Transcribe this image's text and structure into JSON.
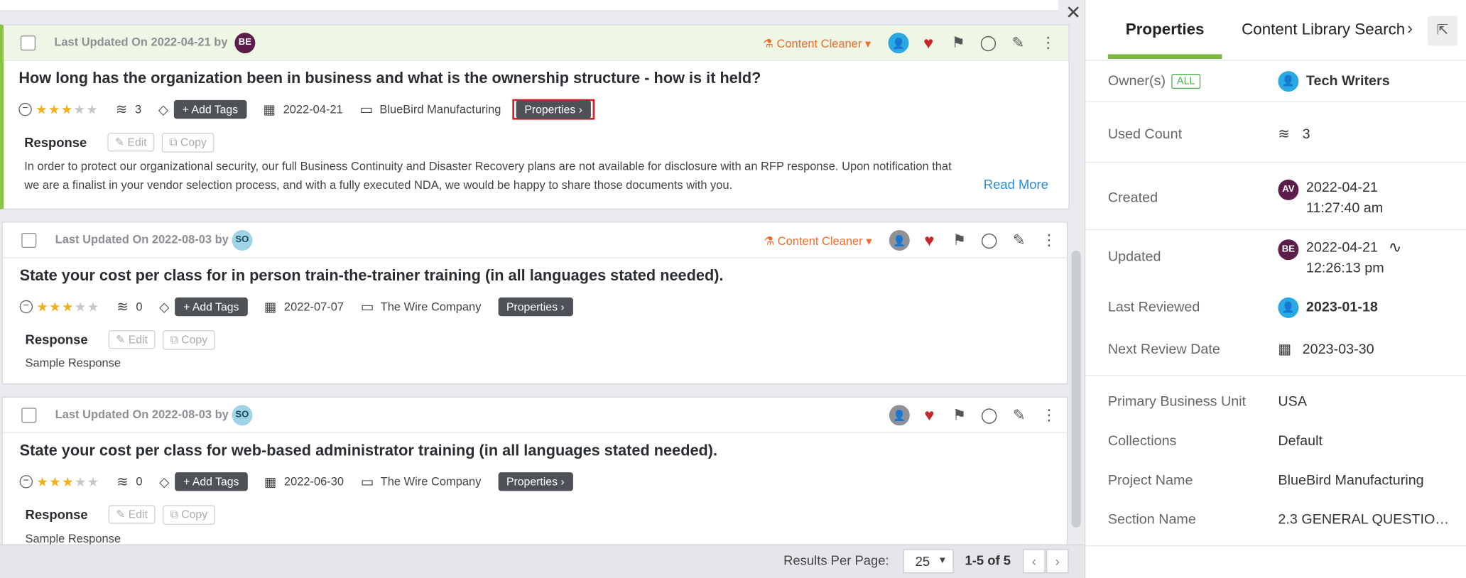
{
  "list": {
    "cards": [
      {
        "updated_label": "Last Updated On 2022-04-21 by",
        "avatar": "BE",
        "content_cleaner": "Content Cleaner",
        "question": "How long has the organization been in business and what is the ownership structure - how is it held?",
        "rating": 3,
        "used_count": "3",
        "add_tags": "+ Add Tags",
        "date": "2022-04-21",
        "project": "BlueBird Manufacturing",
        "properties": "Properties",
        "response_label": "Response",
        "edit": "Edit",
        "copy": "Copy",
        "response_text": "In order to protect our organizational security, our full Business Continuity and Disaster Recovery plans are not available for disclosure with an RFP response. Upon notification that we are a finalist in your vendor selection process, and with a fully executed NDA, we would be happy to share those documents with you.",
        "read_more": "Read More"
      },
      {
        "updated_label": "Last Updated On 2022-08-03 by",
        "avatar": "SO",
        "content_cleaner": "Content Cleaner",
        "question": "State your cost per class for in person train-the-trainer training (in all languages stated needed).",
        "rating": 3,
        "used_count": "0",
        "add_tags": "+ Add Tags",
        "date": "2022-07-07",
        "project": "The Wire Company",
        "properties": "Properties",
        "response_label": "Response",
        "edit": "Edit",
        "copy": "Copy",
        "response_text": "Sample Response"
      },
      {
        "updated_label": "Last Updated On 2022-08-03 by",
        "avatar": "SO",
        "question": "State your cost per class for web-based administrator training (in all languages stated needed).",
        "rating": 3,
        "used_count": "0",
        "add_tags": "+ Add Tags",
        "date": "2022-06-30",
        "project": "The Wire Company",
        "properties": "Properties",
        "response_label": "Response",
        "edit": "Edit",
        "copy": "Copy",
        "response_text": "Sample Response"
      }
    ]
  },
  "footer": {
    "results_per_page": "Results Per Page:",
    "per_page_value": "25",
    "range": "1-5 of 5"
  },
  "panel": {
    "tabs": [
      "Properties",
      "Content Library Search"
    ],
    "rows": {
      "owners_label": "Owner(s)",
      "owners_badge": "ALL",
      "owners_value": "Tech Writers",
      "used_label": "Used Count",
      "used_value": "3",
      "created_label": "Created",
      "created_avatar": "AV",
      "created_date": "2022-04-21",
      "created_time": "11:27:40 am",
      "updated_label": "Updated",
      "updated_avatar": "BE",
      "updated_date": "2022-04-21",
      "updated_time": "12:26:13 pm",
      "reviewed_label": "Last Reviewed",
      "reviewed_value": "2023-01-18",
      "next_label": "Next Review Date",
      "next_value": "2023-03-30",
      "pbu_label": "Primary Business Unit",
      "pbu_value": "USA",
      "collections_label": "Collections",
      "collections_value": "Default",
      "project_label": "Project Name",
      "project_value": "BlueBird Manufacturing",
      "section_label": "Section Name",
      "section_value": "2.3 GENERAL QUESTIO…"
    }
  }
}
